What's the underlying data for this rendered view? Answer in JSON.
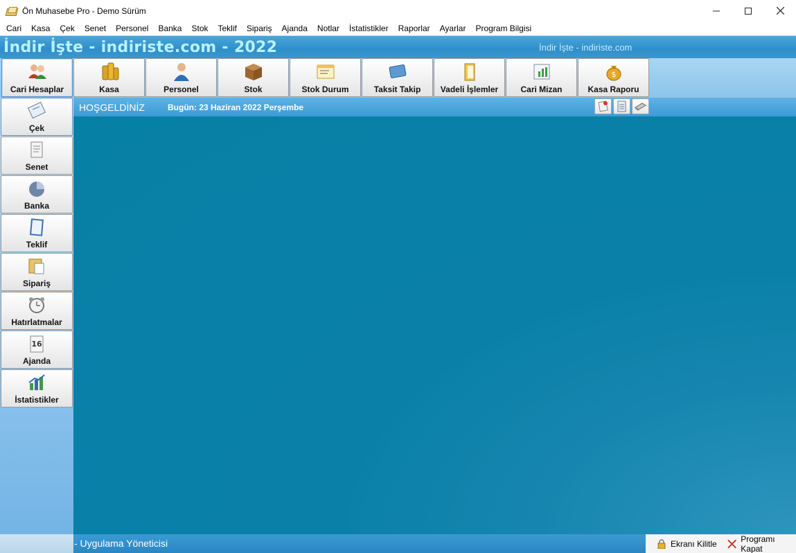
{
  "window": {
    "title": "Ön Muhasebe Pro - Demo Sürüm",
    "controls": [
      "minimize",
      "maximize",
      "close"
    ]
  },
  "menu": [
    "Cari",
    "Kasa",
    "Çek",
    "Senet",
    "Personel",
    "Banka",
    "Stok",
    "Teklif",
    "Sipariş",
    "Ajanda",
    "Notlar",
    "İstatistikler",
    "Raporlar",
    "Ayarlar",
    "Program Bilgisi"
  ],
  "header": {
    "title": "İndir İşte - indiriste.com - 2022",
    "subtitle": "İndir İşte - indiriste.com"
  },
  "toolbar": [
    {
      "label": "Cari Hesaplar",
      "icon": "users-icon"
    },
    {
      "label": "Kasa",
      "icon": "coins-icon"
    },
    {
      "label": "Personel",
      "icon": "person-icon"
    },
    {
      "label": "Stok",
      "icon": "box-icon"
    },
    {
      "label": "Stok Durum",
      "icon": "window-list-icon"
    },
    {
      "label": "Taksit Takip",
      "icon": "card-icon"
    },
    {
      "label": "Vadeli İşlemler",
      "icon": "folder-icon"
    },
    {
      "label": "Cari Mizan",
      "icon": "spreadsheet-icon"
    },
    {
      "label": "Kasa Raporu",
      "icon": "money-bag-icon"
    }
  ],
  "sidebar": [
    {
      "label": "Çek",
      "icon": "cheque-icon"
    },
    {
      "label": "Senet",
      "icon": "document-icon"
    },
    {
      "label": "Banka",
      "icon": "pie-chart-icon"
    },
    {
      "label": "Teklif",
      "icon": "notepad-icon"
    },
    {
      "label": "Sipariş",
      "icon": "order-icon"
    },
    {
      "label": "Hatırlatmalar",
      "icon": "alarm-clock-icon"
    },
    {
      "label": "Ajanda",
      "icon": "calendar-icon",
      "calendar_day": "16"
    },
    {
      "label": "İstatistikler",
      "icon": "bar-chart-icon"
    }
  ],
  "welcome": {
    "title": "HOŞGELDİNİZ",
    "date": "Bugün: 23 Haziran 2022 Perşembe",
    "mini_buttons": [
      "note-icon",
      "clipboard-icon",
      "eraser-icon"
    ]
  },
  "status": {
    "user": "- Uygulama Yöneticisi",
    "lock_label": "Ekranı Kilitle",
    "close_label": "Programı Kapat"
  },
  "colors": {
    "main_bg": "#0780a6",
    "header_text": "#b9f2ff",
    "status_bg": "#2b86c2"
  }
}
